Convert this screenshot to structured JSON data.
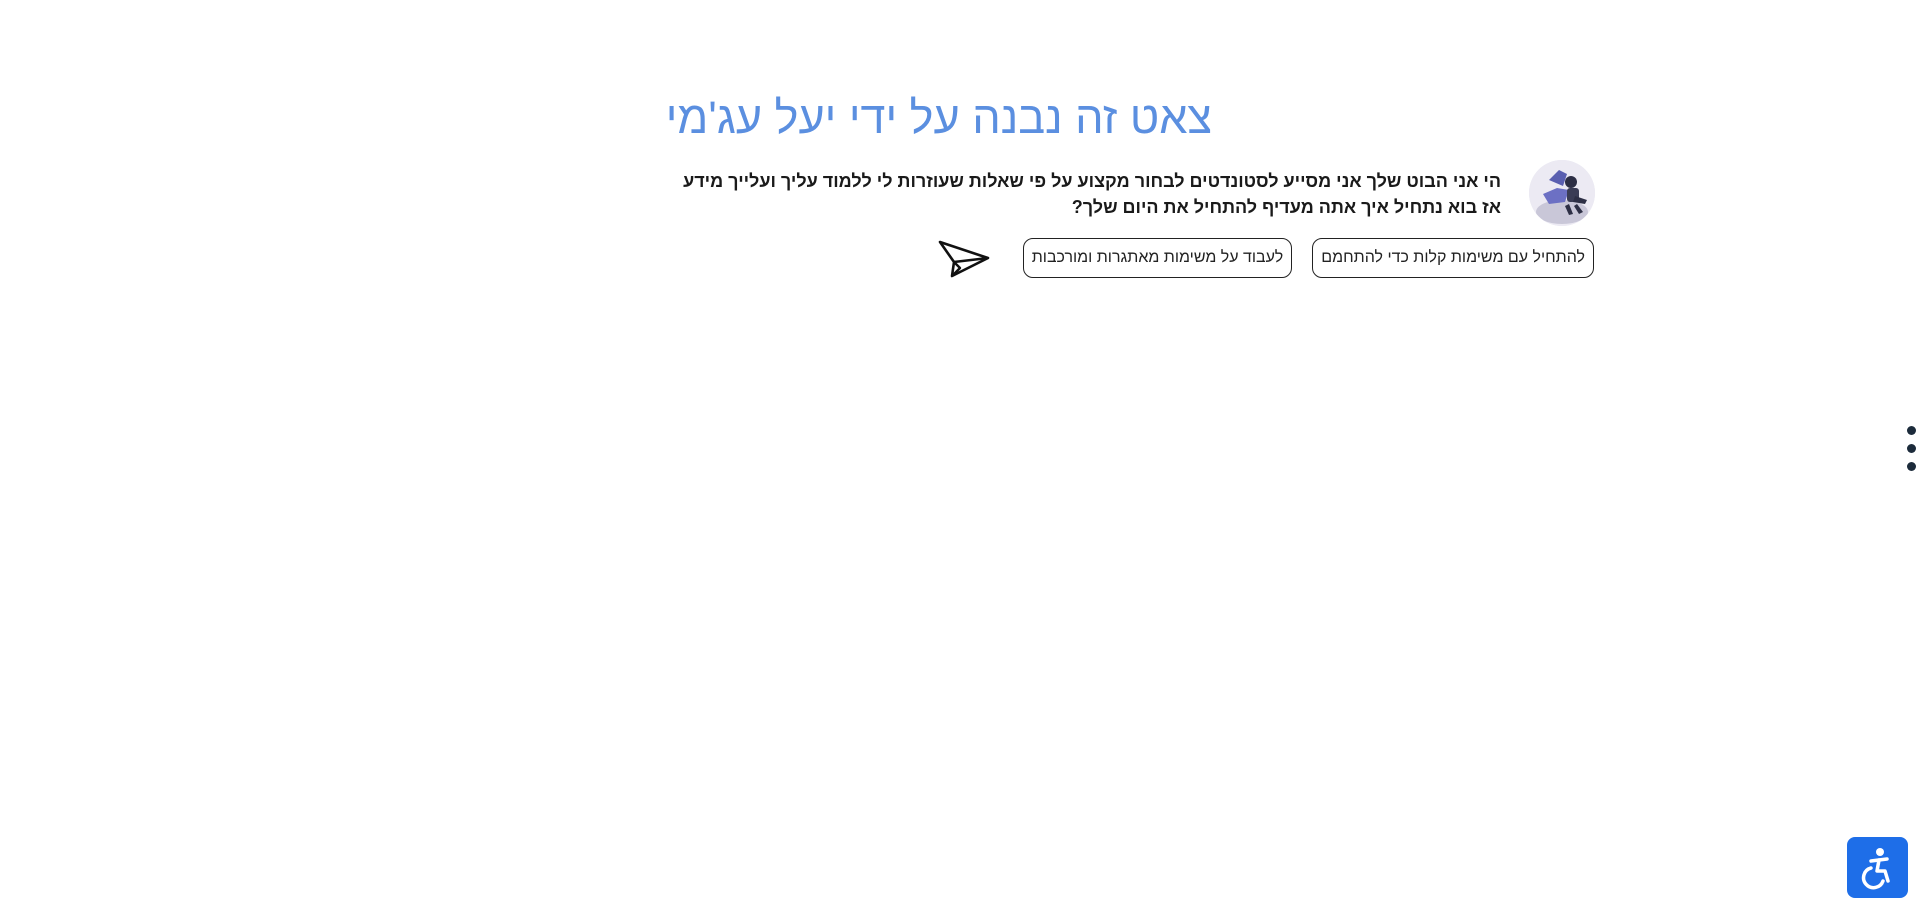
{
  "header": {
    "title": "צאט זה נבנה על ידי יעל עג'מי"
  },
  "chat": {
    "bot_avatar": "robot-avatar",
    "bot_message": "הי אני הבוט שלך אני מסייע לסטונדטים לבחור מקצוע על פי שאלות שעוזרות לי ללמוד עליך ועלייך מידע אז בוא נתחיל איך אתה מעדיף להתחיל את היום שלך?",
    "options": [
      "לעבוד על משימות מאתגרות ומורכבות",
      "להתחיל עם משימות קלות כדי להתחמם"
    ],
    "send_icon": "paper-plane-icon"
  },
  "side_menu": {
    "icon": "vertical-dots-icon"
  },
  "accessibility": {
    "icon": "accessibility-icon",
    "color": "#1e6ee8"
  },
  "colors": {
    "title": "#5b8fe0",
    "text": "#1a1a1a",
    "border": "#222222"
  }
}
